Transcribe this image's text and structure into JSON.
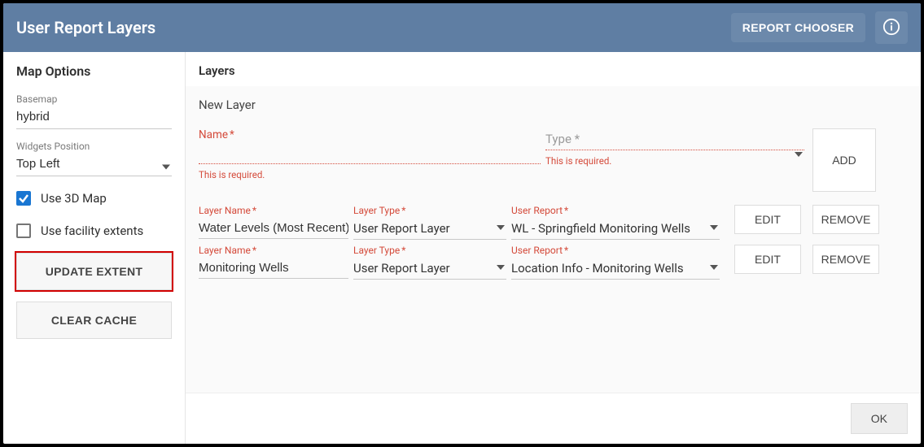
{
  "header": {
    "title": "User Report Layers",
    "report_chooser": "REPORT CHOOSER",
    "info_icon": "info-icon"
  },
  "sidebar": {
    "heading": "Map Options",
    "basemap_label": "Basemap",
    "basemap_value": "hybrid",
    "widgets_label": "Widgets Position",
    "widgets_value": "Top Left",
    "use_3d_label": "Use 3D Map",
    "use_3d_checked": true,
    "use_facility_label": "Use facility extents",
    "use_facility_checked": false,
    "update_extent": "UPDATE EXTENT",
    "clear_cache": "CLEAR CACHE"
  },
  "main": {
    "heading": "Layers",
    "new_layer": "New Layer",
    "name_label": "Name",
    "type_label": "Type",
    "required_msg": "This is required.",
    "add": "ADD",
    "columns": {
      "layer_name": "Layer Name",
      "layer_type": "Layer Type",
      "user_report": "User Report"
    },
    "rows": [
      {
        "name": "Water Levels (Most Recent)",
        "type": "User Report Layer",
        "report": "WL - Springfield Monitoring Wells"
      },
      {
        "name": "Monitoring Wells",
        "type": "User Report Layer",
        "report": "Location Info - Monitoring Wells"
      }
    ],
    "edit": "EDIT",
    "remove": "REMOVE"
  },
  "footer": {
    "ok": "OK"
  }
}
